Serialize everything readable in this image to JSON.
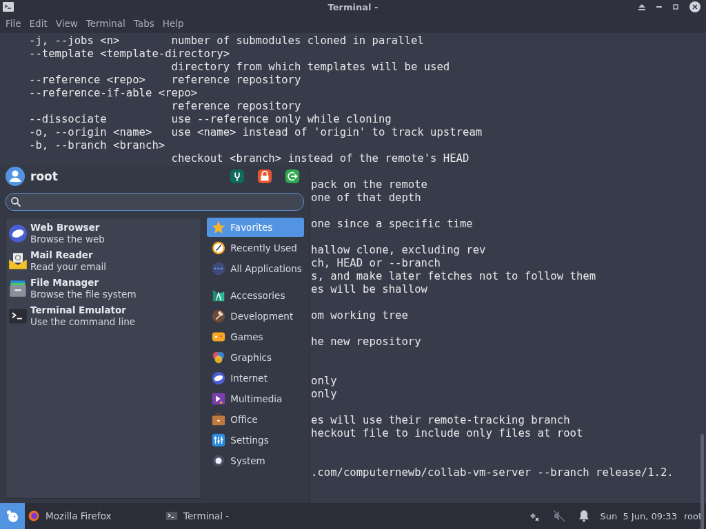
{
  "window": {
    "title": "Terminal -"
  },
  "menubar": [
    "File",
    "Edit",
    "View",
    "Terminal",
    "Tabs",
    "Help"
  ],
  "terminal": {
    "lines": [
      {
        "kind": "full",
        "text": "-j, --jobs <n>        number of submodules cloned in parallel"
      },
      {
        "kind": "full",
        "text": "--template <template-directory>"
      },
      {
        "kind": "full",
        "text": "                      directory from which templates will be used"
      },
      {
        "kind": "full",
        "text": "--reference <repo>    reference repository"
      },
      {
        "kind": "full",
        "text": "--reference-if-able <repo>"
      },
      {
        "kind": "full",
        "text": "                      reference repository"
      },
      {
        "kind": "full",
        "text": "--dissociate          use --reference only while cloning"
      },
      {
        "kind": "full",
        "text": "-o, --origin <name>   use <name> instead of 'origin' to track upstream"
      },
      {
        "kind": "full",
        "text": "-b, --branch <branch>"
      },
      {
        "kind": "full",
        "text": "                      checkout <branch> instead of the remote's HEAD"
      },
      {
        "kind": "blank"
      },
      {
        "kind": "tail",
        "text": "pack on the remote"
      },
      {
        "kind": "tail",
        "text": "one of that depth"
      },
      {
        "kind": "blank"
      },
      {
        "kind": "tail",
        "text": "one since a specific time"
      },
      {
        "kind": "blank"
      },
      {
        "kind": "tail",
        "text": "hallow clone, excluding rev"
      },
      {
        "kind": "tail",
        "text": "ch, HEAD or --branch"
      },
      {
        "kind": "tail",
        "text": "s, and make later fetches not to follow them"
      },
      {
        "kind": "tail",
        "text": "es will be shallow"
      },
      {
        "kind": "blank"
      },
      {
        "kind": "tail",
        "text": "om working tree"
      },
      {
        "kind": "blank"
      },
      {
        "kind": "tail",
        "text": "he new repository"
      },
      {
        "kind": "blank"
      },
      {
        "kind": "blank"
      },
      {
        "kind": "tail",
        "text": "only"
      },
      {
        "kind": "tail",
        "text": "only"
      },
      {
        "kind": "blank"
      },
      {
        "kind": "tail",
        "text": "es will use their remote-tracking branch"
      },
      {
        "kind": "tail",
        "text": "heckout file to include only files at root"
      },
      {
        "kind": "blank"
      },
      {
        "kind": "blank"
      },
      {
        "kind": "tail",
        "text": ".com/computernewb/collab-vm-server --branch release/1.2."
      }
    ]
  },
  "app_menu": {
    "user": "root",
    "header_actions": [
      {
        "kind": "settings",
        "color": "#0f6b5a"
      },
      {
        "kind": "lock",
        "color": "#e8552f"
      },
      {
        "kind": "logout",
        "color": "#2fa84f"
      }
    ],
    "favorites": [
      {
        "kind": "browser",
        "name": "Web Browser",
        "description": "Browse the web"
      },
      {
        "kind": "mail",
        "name": "Mail Reader",
        "description": "Read your email"
      },
      {
        "kind": "files",
        "name": "File Manager",
        "description": "Browse the file system"
      },
      {
        "kind": "terminal",
        "name": "Terminal Emulator",
        "description": "Use the command line"
      }
    ],
    "categories": [
      {
        "kind": "star",
        "label": "Favorites",
        "selected": true
      },
      {
        "kind": "clock",
        "label": "Recently Used",
        "selected": false
      },
      {
        "kind": "dots",
        "label": "All Applications",
        "selected": false
      },
      {
        "kind": "separator"
      },
      {
        "kind": "accessories",
        "label": "Accessories",
        "selected": false
      },
      {
        "kind": "hammer",
        "label": "Development",
        "selected": false
      },
      {
        "kind": "gamepad",
        "label": "Games",
        "selected": false
      },
      {
        "kind": "palette",
        "label": "Graphics",
        "selected": false
      },
      {
        "kind": "browser",
        "label": "Internet",
        "selected": false
      },
      {
        "kind": "media",
        "label": "Multimedia",
        "selected": false
      },
      {
        "kind": "briefcase",
        "label": "Office",
        "selected": false
      },
      {
        "kind": "sliders",
        "label": "Settings",
        "selected": false
      },
      {
        "kind": "gear",
        "label": "System",
        "selected": false
      }
    ]
  },
  "taskbar": {
    "tasks": [
      {
        "kind": "firefox",
        "label": "Mozilla Firefox"
      },
      {
        "kind": "terminal",
        "label": "Terminal -"
      }
    ],
    "clock": "Sun  5 Jun, 09:33",
    "user": "root"
  }
}
